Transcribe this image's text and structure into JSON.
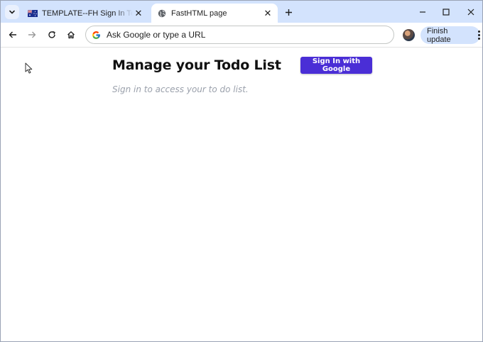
{
  "tabs": [
    {
      "title": "TEMPLATE--FH Sign In Template",
      "active": false,
      "favicon": "australia-flag-icon"
    },
    {
      "title": "FastHTML page",
      "active": true,
      "favicon": "globe-icon"
    }
  ],
  "omnibox": {
    "placeholder": "Ask Google or type a URL"
  },
  "toolbar": {
    "finish_update_label": "Finish update"
  },
  "page": {
    "title": "Manage your Todo List",
    "signin_label": "Sign In with Google",
    "subtitle": "Sign in to access your to do list."
  },
  "colors": {
    "tabstrip": "#d3e3fd",
    "signin_button": "#4a2ed6",
    "subtitle_text": "#9aa0ab"
  }
}
